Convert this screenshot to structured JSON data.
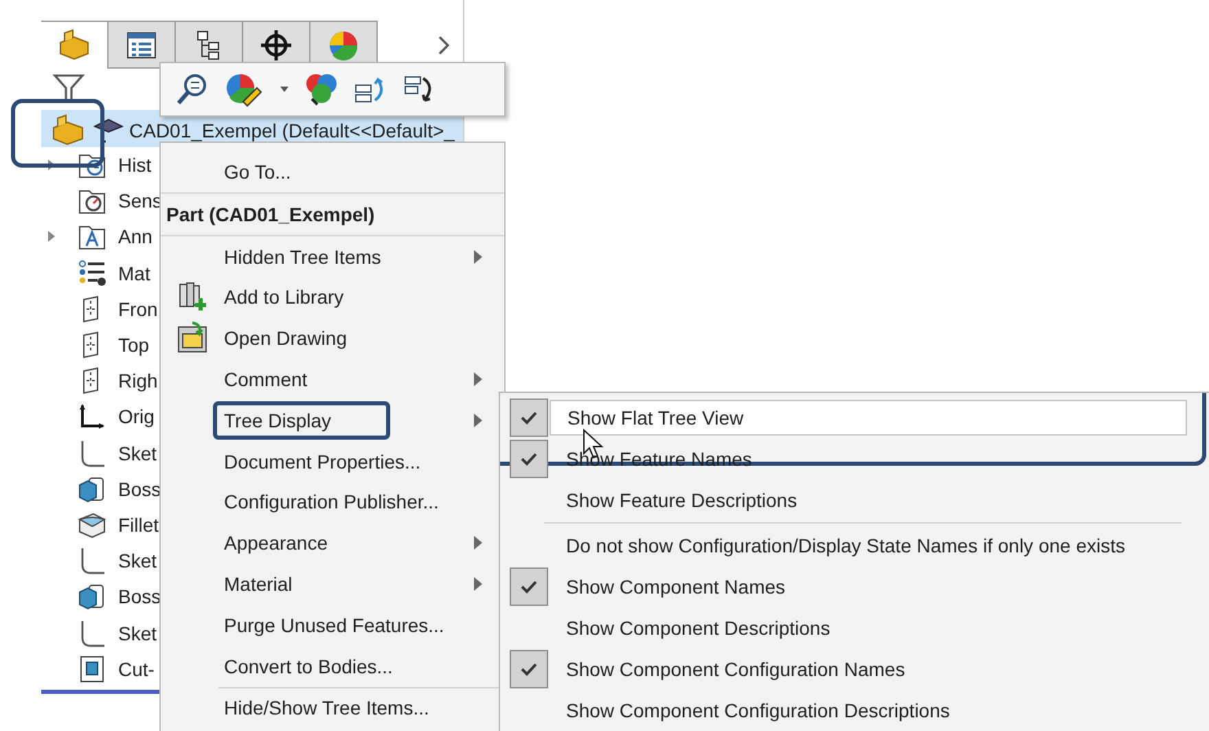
{
  "tabs": [
    {
      "kind": "part",
      "selected": true
    },
    {
      "kind": "properties",
      "selected": false
    },
    {
      "kind": "configurations",
      "selected": false
    },
    {
      "kind": "target",
      "selected": false
    },
    {
      "kind": "display",
      "selected": false
    }
  ],
  "tree": {
    "root": {
      "label": "CAD01_Exempel  (Default<<Default>_",
      "selected": true,
      "highlighted": true
    },
    "items": [
      {
        "label": "Hist",
        "kind": "history",
        "expandable": true
      },
      {
        "label": "Sens",
        "kind": "sensors",
        "expandable": false
      },
      {
        "label": "Ann",
        "kind": "annotations",
        "expandable": true
      },
      {
        "label": "Mat",
        "kind": "material",
        "expandable": false
      },
      {
        "label": "Fron",
        "kind": "plane",
        "expandable": false
      },
      {
        "label": "Top",
        "kind": "plane",
        "expandable": false
      },
      {
        "label": "Righ",
        "kind": "plane",
        "expandable": false
      },
      {
        "label": "Orig",
        "kind": "origin",
        "expandable": false
      },
      {
        "label": "Sket",
        "kind": "sketch",
        "expandable": false
      },
      {
        "label": "Boss",
        "kind": "boss",
        "expandable": false
      },
      {
        "label": "Fillet",
        "kind": "fillet",
        "expandable": false
      },
      {
        "label": "Sket",
        "kind": "sketch",
        "expandable": false
      },
      {
        "label": "Boss",
        "kind": "boss",
        "expandable": false
      },
      {
        "label": "Sket",
        "kind": "sketch",
        "expandable": false
      },
      {
        "label": "Cut-",
        "kind": "cut",
        "expandable": false
      }
    ]
  },
  "toolbar": [
    {
      "kind": "zoom",
      "dropdown": false
    },
    {
      "kind": "appearance",
      "dropdown": true
    },
    {
      "kind": "colors",
      "dropdown": false
    },
    {
      "kind": "rollback",
      "dropdown": false
    },
    {
      "kind": "rebuild",
      "dropdown": false
    }
  ],
  "context_menu": [
    {
      "kind": "item",
      "label": "Go To...",
      "submenu": false,
      "highlighted": false
    },
    {
      "kind": "header",
      "label": "Part (CAD01_Exempel)"
    },
    {
      "kind": "item",
      "label": "Hidden Tree Items",
      "submenu": true,
      "highlighted": false
    },
    {
      "kind": "library",
      "label": "Add to Library",
      "submenu": false,
      "highlighted": false
    },
    {
      "kind": "drawing",
      "label": "Open Drawing",
      "submenu": false,
      "highlighted": false
    },
    {
      "kind": "item",
      "label": "Comment",
      "submenu": true,
      "highlighted": false
    },
    {
      "kind": "item",
      "label": "Tree Display",
      "submenu": true,
      "highlighted": true
    },
    {
      "kind": "item",
      "label": "Document Properties...",
      "submenu": false,
      "highlighted": false
    },
    {
      "kind": "item",
      "label": "Configuration Publisher...",
      "submenu": false,
      "highlighted": false
    },
    {
      "kind": "item",
      "label": "Appearance",
      "submenu": true,
      "highlighted": false
    },
    {
      "kind": "item",
      "label": "Material",
      "submenu": true,
      "highlighted": false
    },
    {
      "kind": "item",
      "label": "Purge Unused Features...",
      "submenu": false,
      "highlighted": false
    },
    {
      "kind": "item",
      "label": "Convert to Bodies...",
      "submenu": false,
      "highlighted": false
    },
    {
      "kind": "separator"
    },
    {
      "kind": "item",
      "label": "Hide/Show Tree Items...",
      "submenu": false,
      "highlighted": false
    }
  ],
  "tree_display_menu": [
    {
      "kind": "item",
      "label": "Show Flat Tree View",
      "checked": true,
      "hovered": true,
      "highlighted": true
    },
    {
      "kind": "item",
      "label": "Show Feature Names",
      "checked": true,
      "hovered": false,
      "highlighted": false
    },
    {
      "kind": "item",
      "label": "Show Feature Descriptions",
      "checked": false,
      "hovered": false,
      "highlighted": false
    },
    {
      "kind": "separator"
    },
    {
      "kind": "item",
      "label": "Do not show Configuration/Display State Names if only one exists",
      "checked": false,
      "hovered": false,
      "highlighted": false
    },
    {
      "kind": "item",
      "label": "Show Component Names",
      "checked": true,
      "hovered": false,
      "highlighted": false
    },
    {
      "kind": "item",
      "label": "Show Component Descriptions",
      "checked": false,
      "hovered": false,
      "highlighted": false
    },
    {
      "kind": "item",
      "label": "Show Component Configuration Names",
      "checked": true,
      "hovered": false,
      "highlighted": false
    },
    {
      "kind": "item",
      "label": "Show Component Configuration Descriptions",
      "checked": false,
      "hovered": false,
      "highlighted": false
    }
  ]
}
